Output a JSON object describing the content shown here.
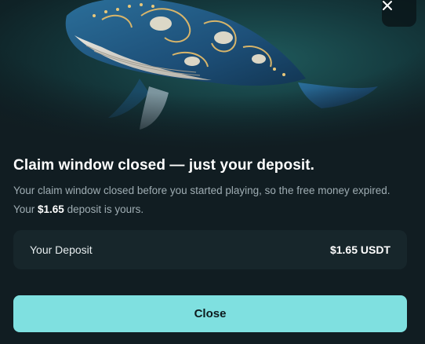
{
  "header": {
    "hero_image": "whale-illustration",
    "close_icon": "close-icon"
  },
  "dialog": {
    "title": "Claim window closed — just your deposit.",
    "description_prefix": "Your claim window closed before you started playing, so the free money expired. Your ",
    "description_amount": "$1.65",
    "description_suffix": " deposit is yours."
  },
  "deposit": {
    "label": "Your Deposit",
    "value": "$1.65 USDT"
  },
  "actions": {
    "close_label": "Close"
  },
  "colors": {
    "background": "#111d22",
    "card": "#17262b",
    "accent": "#7fe0e0",
    "muted_text": "#9fadb3"
  }
}
